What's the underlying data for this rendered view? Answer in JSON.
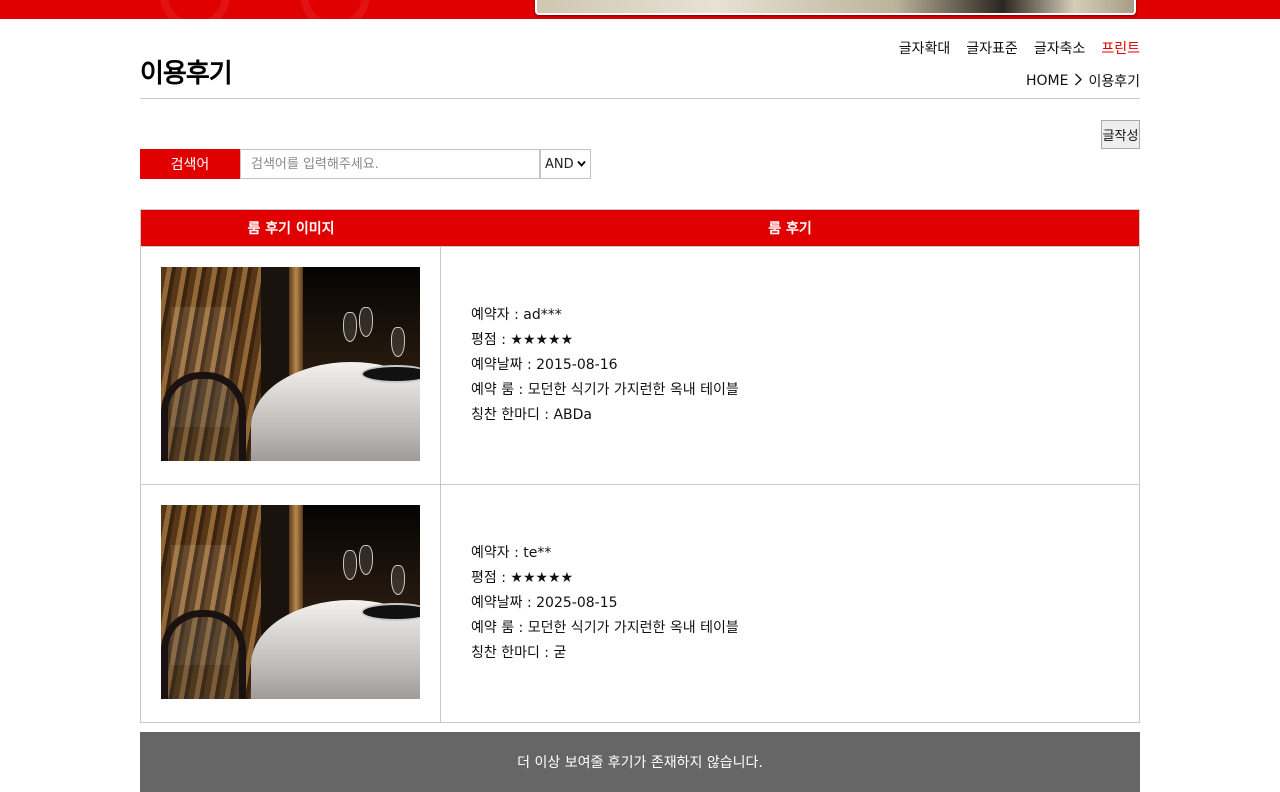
{
  "header": {
    "page_title": "이용후기",
    "font_tools": {
      "enlarge": "글자확대",
      "standard": "글자표준",
      "shrink": "글자축소",
      "print": "프린트"
    },
    "breadcrumb": {
      "home": "HOME",
      "separator_icon": "chevron-right-icon",
      "current": "이용후기"
    }
  },
  "toolbar": {
    "write_label": "글작성"
  },
  "search": {
    "label": "검색어",
    "placeholder": "검색어를 입력해주세요.",
    "value": "",
    "operator_selected": "AND"
  },
  "table": {
    "columns": [
      "룸 후기 이미지",
      "룸 후기"
    ],
    "rows": [
      {
        "reserver_label": "예약자 : ",
        "reserver": "ad***",
        "rating_label": "평점 : ",
        "rating": "★★★★★",
        "date_label": "예약날짜 : ",
        "date": "2015-08-16",
        "room_label": "예약 룸 : ",
        "room": "모던한 식기가 가지런한 옥내 테이블",
        "comment_label": "칭찬 한마디 : ",
        "comment": "ABDa"
      },
      {
        "reserver_label": "예약자 : ",
        "reserver": "te**",
        "rating_label": "평점 : ",
        "rating": "★★★★★",
        "date_label": "예약날짜 : ",
        "date": "2025-08-15",
        "room_label": "예약 룸 : ",
        "room": "모던한 식기가 가지런한 옥내 테이블",
        "comment_label": "칭찬 한마디 : ",
        "comment": "굳"
      }
    ]
  },
  "footer_message": "더 이상 보여줄 후기가 존재하지 않습니다.",
  "colors": {
    "accent": "#e00000",
    "footer_bar": "#666666",
    "border": "#c8c8c8"
  }
}
